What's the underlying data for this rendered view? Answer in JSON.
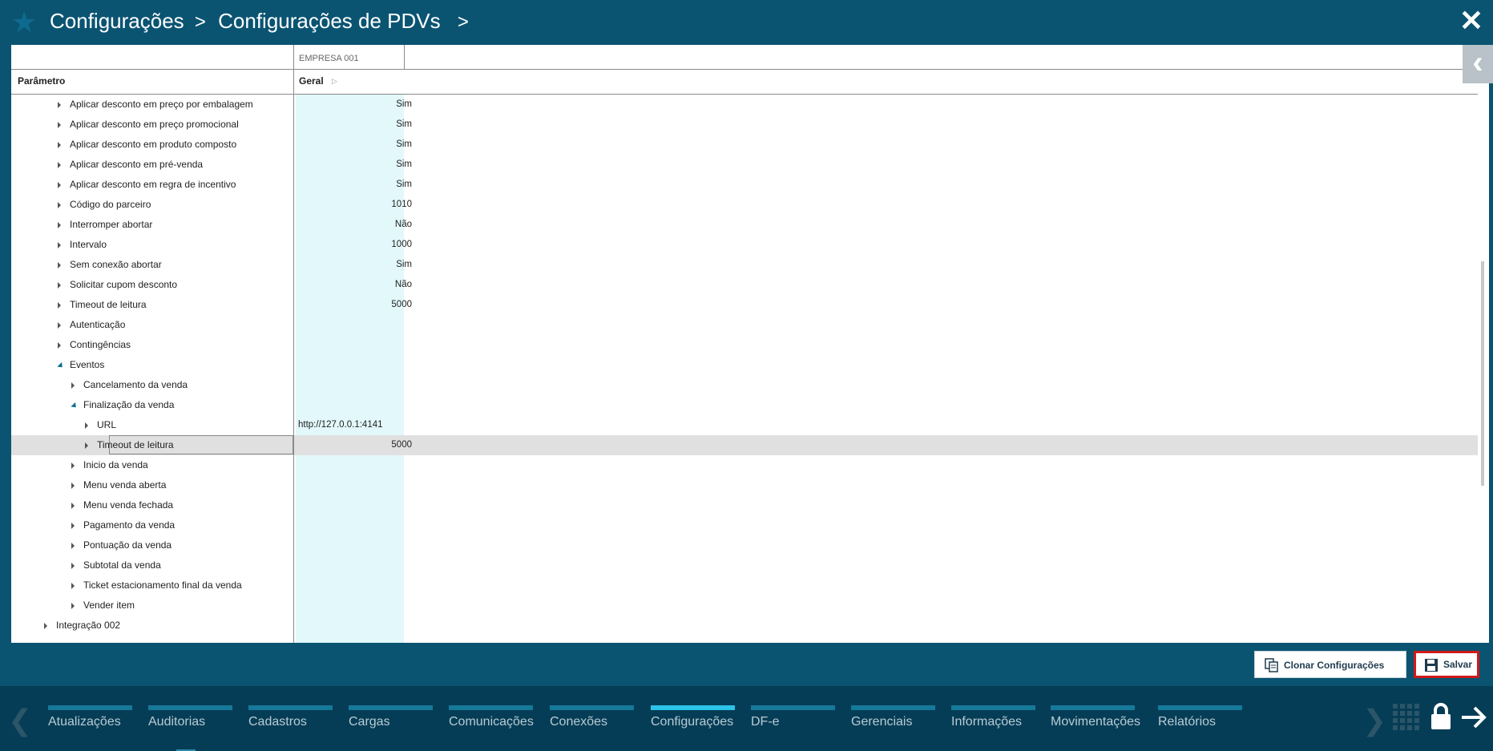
{
  "header": {
    "crumb1": "Configurações",
    "crumb2": "Configurações de PDVs",
    "sep": ">"
  },
  "grid": {
    "company": "EMPRESA 001",
    "col_param": "Parâmetro",
    "col_geral": "Geral",
    "rows": [
      {
        "label": "Aplicar desconto em preço por embalagem",
        "value": "Sim"
      },
      {
        "label": "Aplicar desconto em preço promocional",
        "value": "Sim"
      },
      {
        "label": "Aplicar desconto em produto composto",
        "value": "Sim"
      },
      {
        "label": "Aplicar desconto em pré-venda",
        "value": "Sim"
      },
      {
        "label": "Aplicar desconto em regra de incentivo",
        "value": "Sim"
      },
      {
        "label": "Código do parceiro",
        "value": "1010"
      },
      {
        "label": "Interromper abortar",
        "value": "Não"
      },
      {
        "label": "Intervalo",
        "value": "1000"
      },
      {
        "label": "Sem conexão abortar",
        "value": "Sim"
      },
      {
        "label": "Solicitar cupom desconto",
        "value": "Não"
      },
      {
        "label": "Timeout de leitura",
        "value": "5000"
      },
      {
        "label": "Autenticação",
        "value": ""
      },
      {
        "label": "Contingências",
        "value": ""
      },
      {
        "label": "Eventos",
        "value": ""
      },
      {
        "label": "Cancelamento da venda",
        "value": ""
      },
      {
        "label": "Finalização da venda",
        "value": ""
      },
      {
        "label": "URL",
        "value": "http://127.0.0.1:4141"
      },
      {
        "label": "Timeout de leitura",
        "value": "5000"
      },
      {
        "label": "Inicio da venda",
        "value": ""
      },
      {
        "label": "Menu venda aberta",
        "value": ""
      },
      {
        "label": "Menu venda fechada",
        "value": ""
      },
      {
        "label": "Pagamento da venda",
        "value": ""
      },
      {
        "label": "Pontuação da venda",
        "value": ""
      },
      {
        "label": "Subtotal da venda",
        "value": ""
      },
      {
        "label": "Ticket estacionamento final da venda",
        "value": ""
      },
      {
        "label": "Vender item",
        "value": ""
      },
      {
        "label": "Integração 002",
        "value": ""
      }
    ]
  },
  "actions": {
    "clone": "Clonar Configurações",
    "save": "Salvar"
  },
  "nav": {
    "items": [
      "Atualizações",
      "Auditorias",
      "Cadastros",
      "Cargas",
      "Comunicações",
      "Conexões",
      "Configurações",
      "DF-e",
      "Gerenciais",
      "Informações",
      "Movimentações",
      "Relatórios"
    ],
    "active": "Configurações"
  },
  "icons": {
    "star": "star-icon",
    "close": "close-icon",
    "collapse": "chevron-left-icon",
    "grid": "apps-grid-icon",
    "lock": "lock-icon",
    "logout": "arrow-right-icon"
  }
}
